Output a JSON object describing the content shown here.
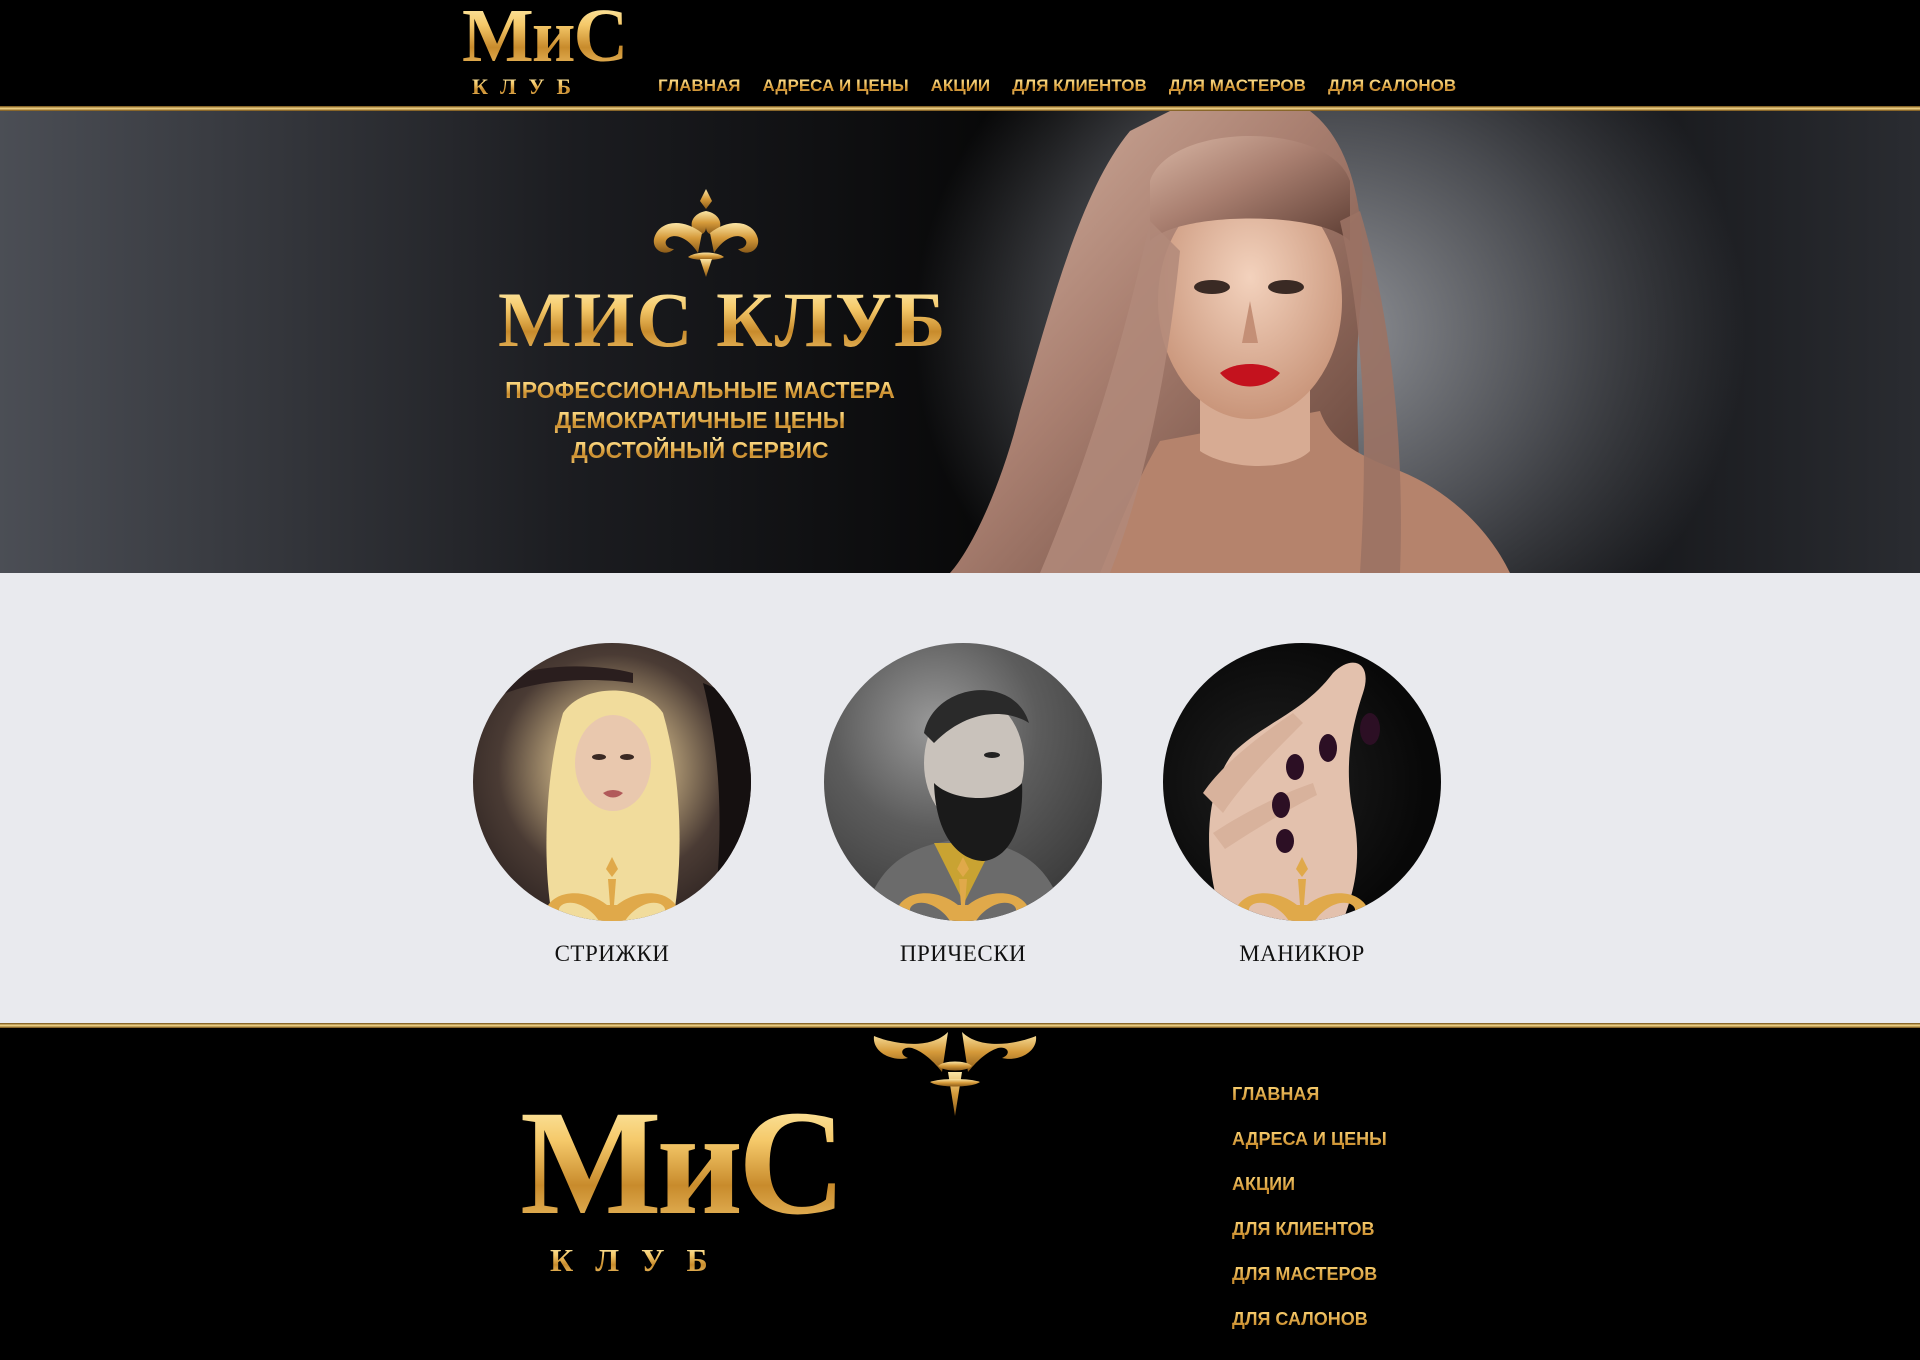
{
  "brand": {
    "logo_main": "МиС",
    "logo_sub": "КЛУБ"
  },
  "nav": {
    "items": [
      {
        "label": "ГЛАВНАЯ"
      },
      {
        "label": "АДРЕСА И ЦЕНЫ"
      },
      {
        "label": "АКЦИИ"
      },
      {
        "label": "ДЛЯ КЛИЕНТОВ"
      },
      {
        "label": "ДЛЯ МАСТЕРОВ"
      },
      {
        "label": "ДЛЯ САЛОНОВ"
      }
    ]
  },
  "hero": {
    "title": "МИС КЛУБ",
    "lines": [
      "ПРОФЕССИОНАЛЬНЫЕ МАСТЕРА",
      "ДЕМОКРАТИЧНЫЕ ЦЕНЫ",
      "ДОСТОЙНЫЙ СЕРВИС"
    ]
  },
  "services": [
    {
      "label": "СТРИЖКИ"
    },
    {
      "label": "ПРИЧЕСКИ"
    },
    {
      "label": "МАНИКЮР"
    }
  ],
  "footer": {
    "logo_main": "МиС",
    "logo_sub": "КЛУБ",
    "nav": [
      "ГЛАВНАЯ",
      "АДРЕСА И ЦЕНЫ",
      "АКЦИИ",
      "ДЛЯ КЛИЕНТОВ",
      "ДЛЯ МАСТЕРОВ",
      "ДЛЯ САЛОНОВ"
    ]
  },
  "colors": {
    "gold": "#e9b95a",
    "background": "#000000",
    "services_bg": "#e9eaee"
  }
}
